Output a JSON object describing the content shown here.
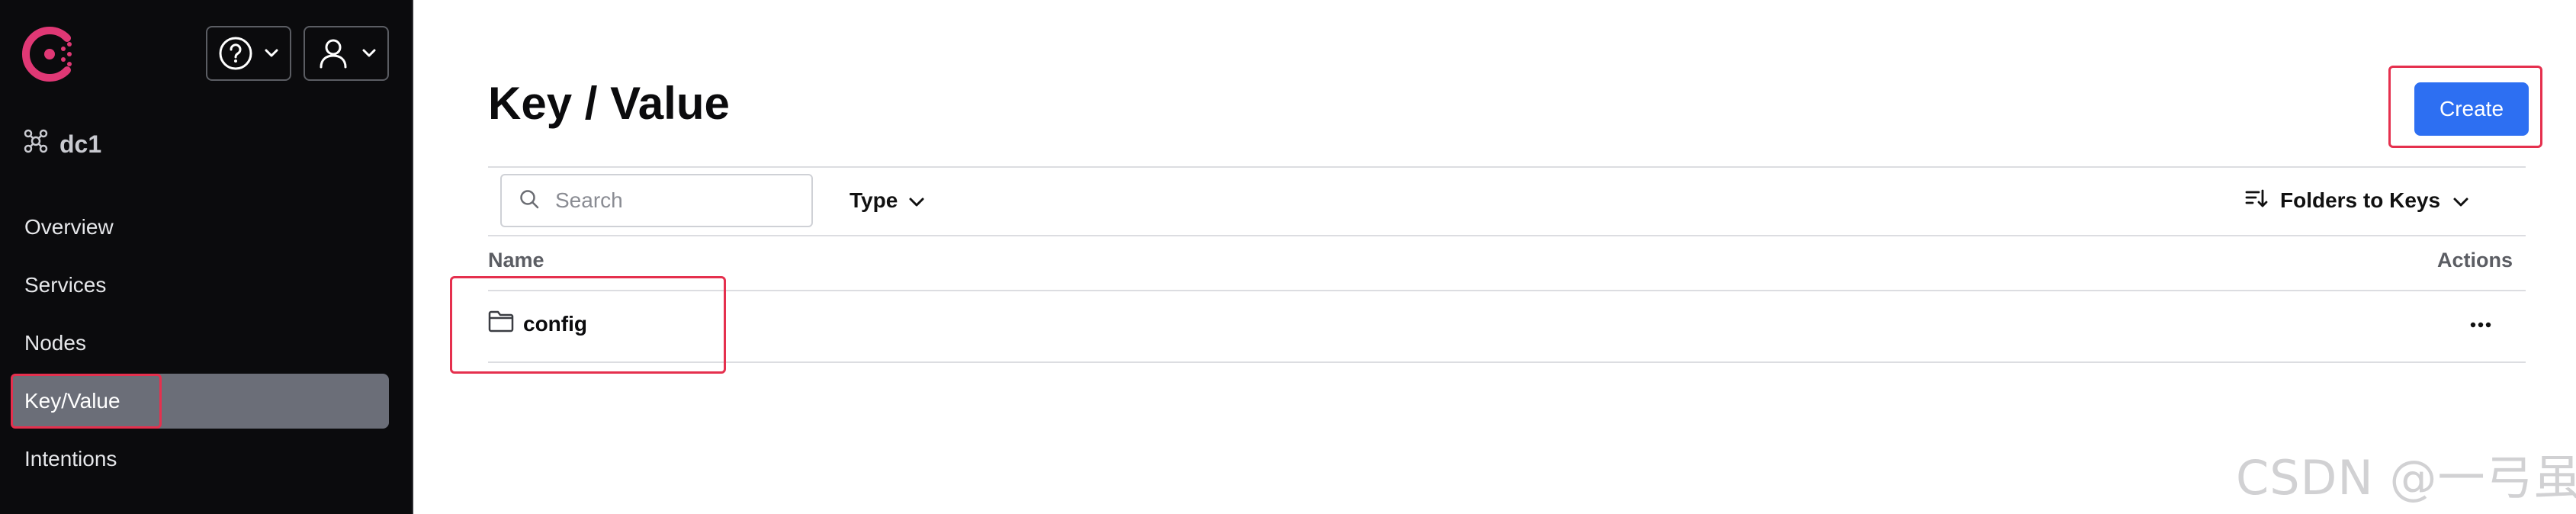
{
  "app": {
    "logo_icon": "consul-logo-icon",
    "brand_color": "#e03875"
  },
  "header": {
    "help_icon": "help-circle-icon",
    "user_icon": "user-icon"
  },
  "datacenter": {
    "name": "dc1",
    "icon": "datacenter-icon"
  },
  "sidebar": {
    "items": [
      {
        "label": "Overview",
        "active": false
      },
      {
        "label": "Services",
        "active": false
      },
      {
        "label": "Nodes",
        "active": false
      },
      {
        "label": "Key/Value",
        "active": true
      },
      {
        "label": "Intentions",
        "active": false
      }
    ]
  },
  "main": {
    "title": "Key / Value",
    "create_label": "Create",
    "search": {
      "placeholder": "Search",
      "value": ""
    },
    "type_filter_label": "Type",
    "sort_label": "Folders to Keys",
    "table": {
      "columns": [
        "Name",
        "Actions"
      ],
      "rows": [
        {
          "name": "config",
          "kind": "folder",
          "actions_icon": "more-horizontal-icon"
        }
      ]
    }
  },
  "colors": {
    "primary_button": "#2d6ff2",
    "active_nav": "#6b6e78",
    "annotation": "#e5304e",
    "sidebar_bg": "#0b0b0d"
  },
  "watermark": "CSDN @一弓虽"
}
